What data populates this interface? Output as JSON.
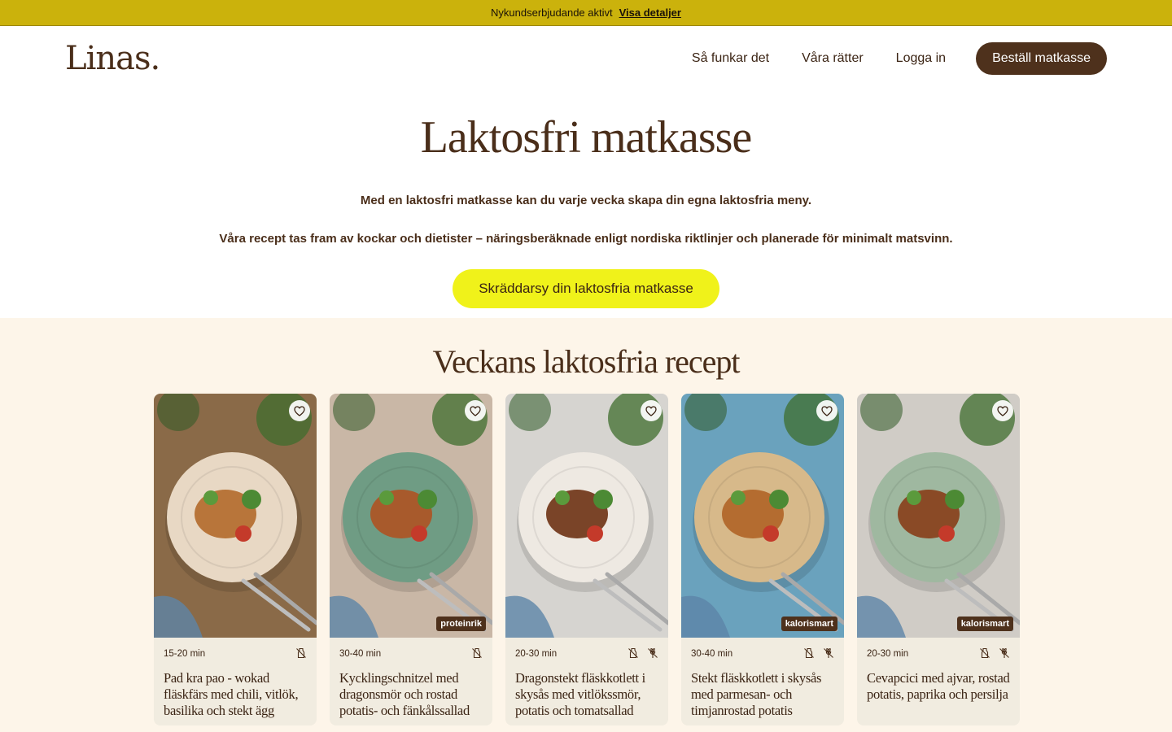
{
  "promo": {
    "text": "Nykundserbjudande aktivt",
    "link": "Visa detaljer"
  },
  "nav": {
    "logo": "Linas.",
    "links": [
      "Så funkar det",
      "Våra rätter",
      "Logga in"
    ],
    "cta": "Beställ matkasse"
  },
  "hero": {
    "title": "Laktosfri matkasse",
    "p1": "Med en laktosfri matkasse kan du varje vecka skapa din egna laktosfria meny.",
    "p2": "Våra recept tas fram av kockar och dietister – näringsberäknade enligt nordiska riktlinjer och planerade för minimalt matsvinn.",
    "cta": "Skräddarsy din laktosfria matkasse"
  },
  "recipes": {
    "heading": "Veckans laktosfria recept",
    "cards": [
      {
        "time": "15-20 min",
        "title": "Pad kra pao - wokad fläskfärs med chili, vitlök, basilika och stekt ägg",
        "tag": "",
        "icons": [
          "no-milk-icon"
        ],
        "bg": "#8a6a48",
        "plate": "#e8d8c4",
        "food": "#b8753a"
      },
      {
        "time": "30-40 min",
        "title": "Kycklingschnitzel med dragonsmör och rostad potatis- och fänkålssallad",
        "tag": "proteinrik",
        "icons": [
          "no-milk-icon"
        ],
        "bg": "#c9b7a6",
        "plate": "#6f9c84",
        "food": "#a85a2c"
      },
      {
        "time": "20-30 min",
        "title": "Dragonstekt fläskkotlett i skysås med vitlökssmör, potatis och tomatsallad",
        "tag": "",
        "icons": [
          "no-milk-icon",
          "no-gluten-icon"
        ],
        "bg": "#d6d4d0",
        "plate": "#eee9e2",
        "food": "#7a4428"
      },
      {
        "time": "30-40 min",
        "title": "Stekt fläskkotlett i skysås med parmesan- och timjanrostad potatis",
        "tag": "kalorismart",
        "icons": [
          "no-milk-icon",
          "no-gluten-icon"
        ],
        "bg": "#6aa2bd",
        "plate": "#d7b98a",
        "food": "#b46c30"
      },
      {
        "time": "20-30 min",
        "title": "Cevapcici med ajvar, rostad potatis, paprika och persilja",
        "tag": "kalorismart",
        "icons": [
          "no-milk-icon",
          "no-gluten-icon"
        ],
        "bg": "#d0ccc6",
        "plate": "#9fb8a0",
        "food": "#8a4a26"
      }
    ]
  }
}
